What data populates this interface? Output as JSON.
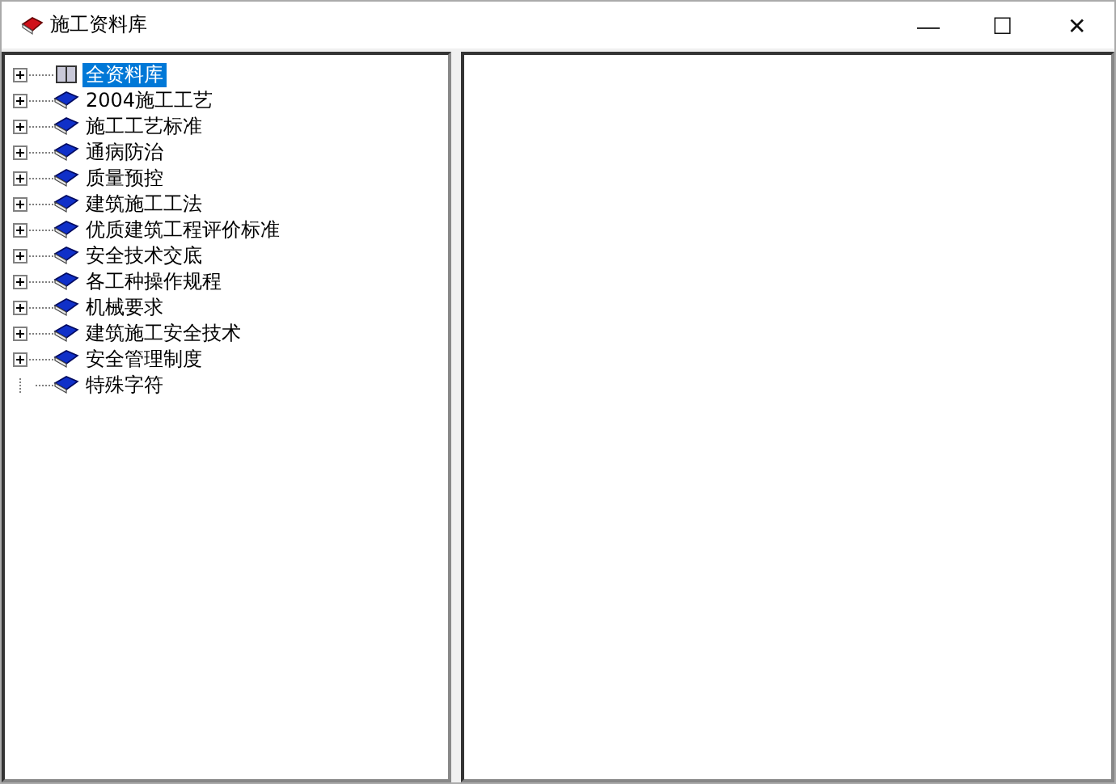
{
  "window": {
    "title": "施工资料库",
    "controls": [
      "—",
      "☐",
      "✕"
    ]
  },
  "tree": {
    "items": [
      {
        "label": "全资料库",
        "expandable": true,
        "selected": true,
        "kind": "root"
      },
      {
        "label": "2004施工工艺",
        "expandable": true,
        "selected": false,
        "kind": "book"
      },
      {
        "label": "施工工艺标准",
        "expandable": true,
        "selected": false,
        "kind": "book"
      },
      {
        "label": "通病防治",
        "expandable": true,
        "selected": false,
        "kind": "book"
      },
      {
        "label": "质量预控",
        "expandable": true,
        "selected": false,
        "kind": "book"
      },
      {
        "label": "建筑施工工法",
        "expandable": true,
        "selected": false,
        "kind": "book"
      },
      {
        "label": "优质建筑工程评价标准",
        "expandable": true,
        "selected": false,
        "kind": "book"
      },
      {
        "label": "安全技术交底",
        "expandable": true,
        "selected": false,
        "kind": "book"
      },
      {
        "label": "各工种操作规程",
        "expandable": true,
        "selected": false,
        "kind": "book"
      },
      {
        "label": "机械要求",
        "expandable": true,
        "selected": false,
        "kind": "book"
      },
      {
        "label": "建筑施工安全技术",
        "expandable": true,
        "selected": false,
        "kind": "book"
      },
      {
        "label": "安全管理制度",
        "expandable": true,
        "selected": false,
        "kind": "book"
      },
      {
        "label": "特殊字符",
        "expandable": false,
        "selected": false,
        "kind": "book"
      }
    ]
  }
}
